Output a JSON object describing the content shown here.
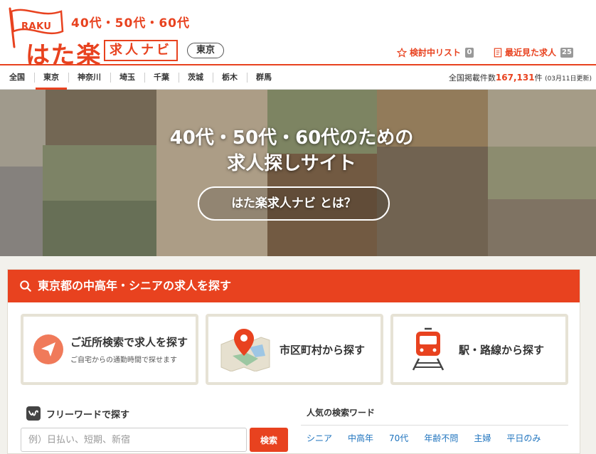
{
  "header": {
    "flag_text": "RAKU",
    "tagline": "40代・50代・60代",
    "brand_main": "はた楽",
    "brand_sub": "求人ナビ",
    "region": "東京",
    "watchlist_label": "検討中リスト",
    "watchlist_count": "0",
    "recent_label": "最近見た求人",
    "recent_count": "25",
    "accent_color": "#e8421f"
  },
  "tabs": {
    "items": [
      "全国",
      "東京",
      "神奈川",
      "埼玉",
      "千葉",
      "茨城",
      "栃木",
      "群馬"
    ],
    "active": "東京",
    "info_prefix": "全国掲載件数",
    "info_count": "167,131",
    "info_unit": "件",
    "info_updated": "(03月11日更新)"
  },
  "hero": {
    "title_line1": "40代・50代・60代のための",
    "title_line2": "求人探しサイト",
    "button": "はた楽求人ナビ とは？"
  },
  "search": {
    "heading": "東京都の中高年・シニアの求人を探す",
    "cards": [
      {
        "title": "ご近所検索で求人を探す",
        "sub": "ご自宅からの通勤時間で探せます",
        "icon": "navigation-arrow-icon"
      },
      {
        "title": "市区町村から探す",
        "icon": "map-pin-icon"
      },
      {
        "title": "駅・路線から探す",
        "icon": "train-icon"
      }
    ],
    "freeword_label": "フリーワードで探す",
    "freeword_placeholder": "例）日払い、短期、新宿",
    "search_button": "検索",
    "popular_label": "人気の検索ワード",
    "popular_words": [
      "シニア",
      "中高年",
      "70代",
      "年齢不問",
      "主婦",
      "平日のみ"
    ]
  }
}
